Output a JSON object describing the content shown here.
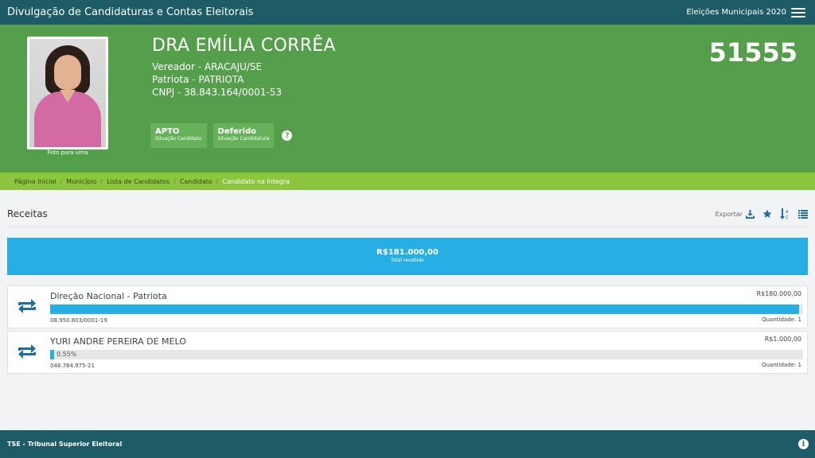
{
  "header": {
    "title": "Divulgação de Candidaturas e Contas Eleitorais",
    "election": "Eleições Municipais 2020"
  },
  "candidate": {
    "name": "DRA EMÍLIA CORRÊA",
    "office": "Vereador - ARACAJU/SE",
    "party": "Patriota - PATRIOTA",
    "cnpj": "CNPJ - 38.843.164/0001-53",
    "number": "51555",
    "photo_caption": "Foto para urna",
    "status": [
      {
        "title": "APTO",
        "subtitle": "Situação Candidato"
      },
      {
        "title": "Deferido",
        "subtitle": "Situação Candidatura"
      }
    ]
  },
  "breadcrumb": [
    {
      "label": "Página Inicial"
    },
    {
      "label": "Município"
    },
    {
      "label": "Lista de Candidatos"
    },
    {
      "label": "Candidato"
    },
    {
      "label": "Candidato na Íntegra"
    }
  ],
  "section": {
    "title": "Receitas",
    "export_label": "Exportar"
  },
  "total": {
    "value": "R$181.000,00",
    "label": "Total recebido"
  },
  "receipts": [
    {
      "name": "Direção Nacional - Patriota",
      "amount": "R$180.000,00",
      "doc": "08.950.803/0001-19",
      "quantity": "Quantidade: 1",
      "percent": 99.45,
      "percent_label": ""
    },
    {
      "name": "YURI ANDRE PEREIRA DE MELO",
      "amount": "R$1.000,00",
      "doc": "048.784.975-21",
      "quantity": "Quantidade: 1",
      "percent": 0.55,
      "percent_label": "0.55%"
    }
  ],
  "footer": {
    "text": "TSE - Tribunal Superior Eleitoral"
  },
  "colors": {
    "topbar": "#1d5c66",
    "hero": "#559e4c",
    "breadcrumb": "#8cc63f",
    "accent": "#27aee4"
  }
}
